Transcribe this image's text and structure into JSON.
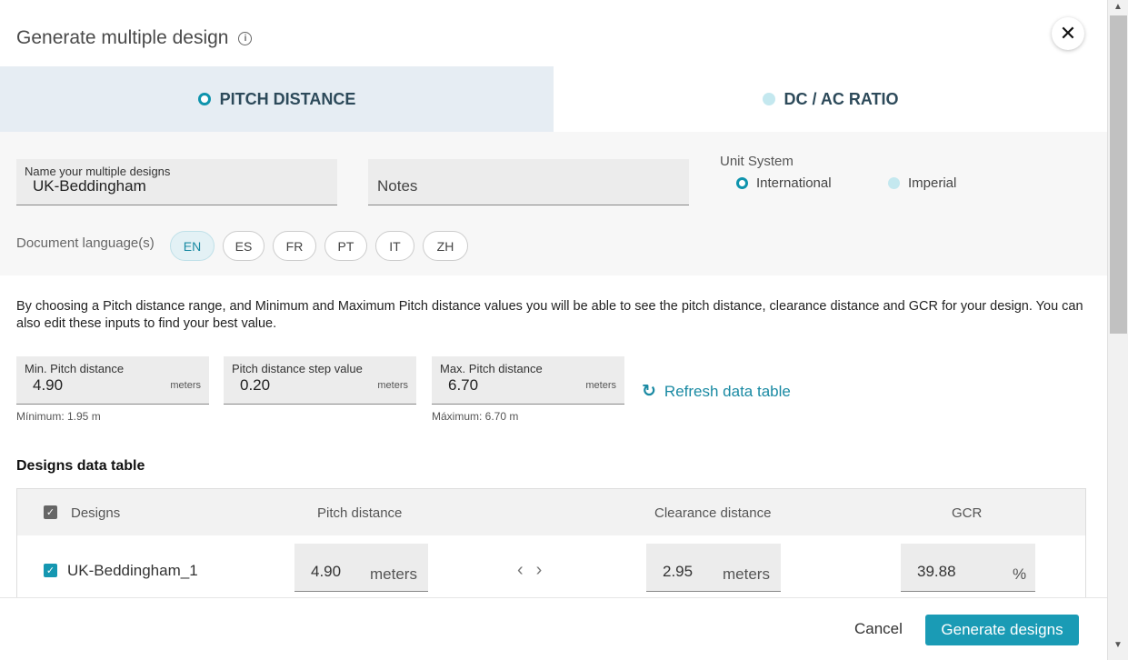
{
  "dialog": {
    "title": "Generate multiple design",
    "info_icon": "info-icon",
    "close_icon": "close-icon",
    "close_glyph": "✕"
  },
  "tabs": [
    {
      "label": "PITCH DISTANCE",
      "active": true
    },
    {
      "label": "DC / AC RATIO",
      "active": false
    }
  ],
  "settings": {
    "name_field": {
      "label": "Name your multiple designs",
      "value": "UK-Beddingham"
    },
    "notes_field": {
      "placeholder": "Notes",
      "value": ""
    },
    "unit_system": {
      "label": "Unit System",
      "options": [
        {
          "label": "International",
          "selected": true
        },
        {
          "label": "Imperial",
          "selected": false
        }
      ]
    },
    "document_language": {
      "label": "Document language(s)",
      "options": [
        {
          "code": "EN",
          "selected": true
        },
        {
          "code": "ES",
          "selected": false
        },
        {
          "code": "FR",
          "selected": false
        },
        {
          "code": "PT",
          "selected": false
        },
        {
          "code": "IT",
          "selected": false
        },
        {
          "code": "ZH",
          "selected": false
        }
      ]
    }
  },
  "description": "By choosing a Pitch distance range, and Minimum and Maximum Pitch distance values you will be able to see the pitch distance, clearance distance and GCR for your design. You can also edit these inputs to find your best value.",
  "pitch_inputs": {
    "min": {
      "label": "Min. Pitch distance",
      "value": "4.90",
      "unit": "meters",
      "hint": "Mínimum: 1.95 m"
    },
    "step": {
      "label": "Pitch distance step value",
      "value": "0.20",
      "unit": "meters"
    },
    "max": {
      "label": "Max. Pitch distance",
      "value": "6.70",
      "unit": "meters",
      "hint": "Máximum: 6.70 m"
    },
    "refresh_label": "Refresh data table",
    "refresh_icon": "refresh-icon",
    "refresh_glyph": "↻"
  },
  "designs_table": {
    "title": "Designs data table",
    "columns": [
      "Designs",
      "Pitch distance",
      "Clearance distance",
      "GCR"
    ],
    "rows": [
      {
        "name": "UK-Beddingham_1",
        "checked": true,
        "pitch_value": "4.90",
        "pitch_unit": "meters",
        "clearance_value": "2.95",
        "clearance_unit": "meters",
        "gcr_value": "39.88",
        "gcr_unit": "%"
      }
    ],
    "arrows_glyph": "‹›",
    "check_glyph": "✓"
  },
  "footer": {
    "cancel_label": "Cancel",
    "generate_label": "Generate designs"
  },
  "colors": {
    "accent": "#1a9bb5",
    "tab_active_bg": "#e6edf3",
    "tab_text": "#2d4a5a"
  }
}
